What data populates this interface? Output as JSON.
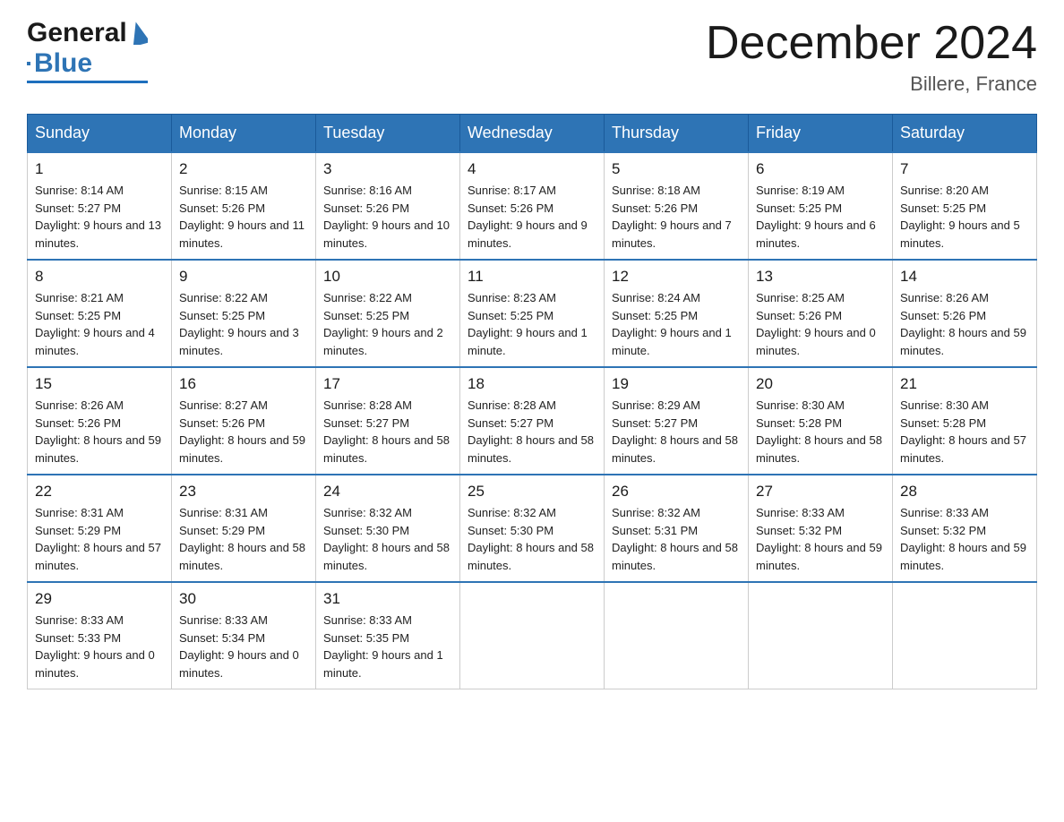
{
  "header": {
    "logo": {
      "general": "General",
      "blue": "Blue"
    },
    "title": "December 2024",
    "location": "Billere, France"
  },
  "calendar": {
    "days_of_week": [
      "Sunday",
      "Monday",
      "Tuesday",
      "Wednesday",
      "Thursday",
      "Friday",
      "Saturday"
    ],
    "weeks": [
      [
        {
          "day": "1",
          "sunrise": "Sunrise: 8:14 AM",
          "sunset": "Sunset: 5:27 PM",
          "daylight": "Daylight: 9 hours and 13 minutes."
        },
        {
          "day": "2",
          "sunrise": "Sunrise: 8:15 AM",
          "sunset": "Sunset: 5:26 PM",
          "daylight": "Daylight: 9 hours and 11 minutes."
        },
        {
          "day": "3",
          "sunrise": "Sunrise: 8:16 AM",
          "sunset": "Sunset: 5:26 PM",
          "daylight": "Daylight: 9 hours and 10 minutes."
        },
        {
          "day": "4",
          "sunrise": "Sunrise: 8:17 AM",
          "sunset": "Sunset: 5:26 PM",
          "daylight": "Daylight: 9 hours and 9 minutes."
        },
        {
          "day": "5",
          "sunrise": "Sunrise: 8:18 AM",
          "sunset": "Sunset: 5:26 PM",
          "daylight": "Daylight: 9 hours and 7 minutes."
        },
        {
          "day": "6",
          "sunrise": "Sunrise: 8:19 AM",
          "sunset": "Sunset: 5:25 PM",
          "daylight": "Daylight: 9 hours and 6 minutes."
        },
        {
          "day": "7",
          "sunrise": "Sunrise: 8:20 AM",
          "sunset": "Sunset: 5:25 PM",
          "daylight": "Daylight: 9 hours and 5 minutes."
        }
      ],
      [
        {
          "day": "8",
          "sunrise": "Sunrise: 8:21 AM",
          "sunset": "Sunset: 5:25 PM",
          "daylight": "Daylight: 9 hours and 4 minutes."
        },
        {
          "day": "9",
          "sunrise": "Sunrise: 8:22 AM",
          "sunset": "Sunset: 5:25 PM",
          "daylight": "Daylight: 9 hours and 3 minutes."
        },
        {
          "day": "10",
          "sunrise": "Sunrise: 8:22 AM",
          "sunset": "Sunset: 5:25 PM",
          "daylight": "Daylight: 9 hours and 2 minutes."
        },
        {
          "day": "11",
          "sunrise": "Sunrise: 8:23 AM",
          "sunset": "Sunset: 5:25 PM",
          "daylight": "Daylight: 9 hours and 1 minute."
        },
        {
          "day": "12",
          "sunrise": "Sunrise: 8:24 AM",
          "sunset": "Sunset: 5:25 PM",
          "daylight": "Daylight: 9 hours and 1 minute."
        },
        {
          "day": "13",
          "sunrise": "Sunrise: 8:25 AM",
          "sunset": "Sunset: 5:26 PM",
          "daylight": "Daylight: 9 hours and 0 minutes."
        },
        {
          "day": "14",
          "sunrise": "Sunrise: 8:26 AM",
          "sunset": "Sunset: 5:26 PM",
          "daylight": "Daylight: 8 hours and 59 minutes."
        }
      ],
      [
        {
          "day": "15",
          "sunrise": "Sunrise: 8:26 AM",
          "sunset": "Sunset: 5:26 PM",
          "daylight": "Daylight: 8 hours and 59 minutes."
        },
        {
          "day": "16",
          "sunrise": "Sunrise: 8:27 AM",
          "sunset": "Sunset: 5:26 PM",
          "daylight": "Daylight: 8 hours and 59 minutes."
        },
        {
          "day": "17",
          "sunrise": "Sunrise: 8:28 AM",
          "sunset": "Sunset: 5:27 PM",
          "daylight": "Daylight: 8 hours and 58 minutes."
        },
        {
          "day": "18",
          "sunrise": "Sunrise: 8:28 AM",
          "sunset": "Sunset: 5:27 PM",
          "daylight": "Daylight: 8 hours and 58 minutes."
        },
        {
          "day": "19",
          "sunrise": "Sunrise: 8:29 AM",
          "sunset": "Sunset: 5:27 PM",
          "daylight": "Daylight: 8 hours and 58 minutes."
        },
        {
          "day": "20",
          "sunrise": "Sunrise: 8:30 AM",
          "sunset": "Sunset: 5:28 PM",
          "daylight": "Daylight: 8 hours and 58 minutes."
        },
        {
          "day": "21",
          "sunrise": "Sunrise: 8:30 AM",
          "sunset": "Sunset: 5:28 PM",
          "daylight": "Daylight: 8 hours and 57 minutes."
        }
      ],
      [
        {
          "day": "22",
          "sunrise": "Sunrise: 8:31 AM",
          "sunset": "Sunset: 5:29 PM",
          "daylight": "Daylight: 8 hours and 57 minutes."
        },
        {
          "day": "23",
          "sunrise": "Sunrise: 8:31 AM",
          "sunset": "Sunset: 5:29 PM",
          "daylight": "Daylight: 8 hours and 58 minutes."
        },
        {
          "day": "24",
          "sunrise": "Sunrise: 8:32 AM",
          "sunset": "Sunset: 5:30 PM",
          "daylight": "Daylight: 8 hours and 58 minutes."
        },
        {
          "day": "25",
          "sunrise": "Sunrise: 8:32 AM",
          "sunset": "Sunset: 5:30 PM",
          "daylight": "Daylight: 8 hours and 58 minutes."
        },
        {
          "day": "26",
          "sunrise": "Sunrise: 8:32 AM",
          "sunset": "Sunset: 5:31 PM",
          "daylight": "Daylight: 8 hours and 58 minutes."
        },
        {
          "day": "27",
          "sunrise": "Sunrise: 8:33 AM",
          "sunset": "Sunset: 5:32 PM",
          "daylight": "Daylight: 8 hours and 59 minutes."
        },
        {
          "day": "28",
          "sunrise": "Sunrise: 8:33 AM",
          "sunset": "Sunset: 5:32 PM",
          "daylight": "Daylight: 8 hours and 59 minutes."
        }
      ],
      [
        {
          "day": "29",
          "sunrise": "Sunrise: 8:33 AM",
          "sunset": "Sunset: 5:33 PM",
          "daylight": "Daylight: 9 hours and 0 minutes."
        },
        {
          "day": "30",
          "sunrise": "Sunrise: 8:33 AM",
          "sunset": "Sunset: 5:34 PM",
          "daylight": "Daylight: 9 hours and 0 minutes."
        },
        {
          "day": "31",
          "sunrise": "Sunrise: 8:33 AM",
          "sunset": "Sunset: 5:35 PM",
          "daylight": "Daylight: 9 hours and 1 minute."
        },
        null,
        null,
        null,
        null
      ]
    ]
  }
}
